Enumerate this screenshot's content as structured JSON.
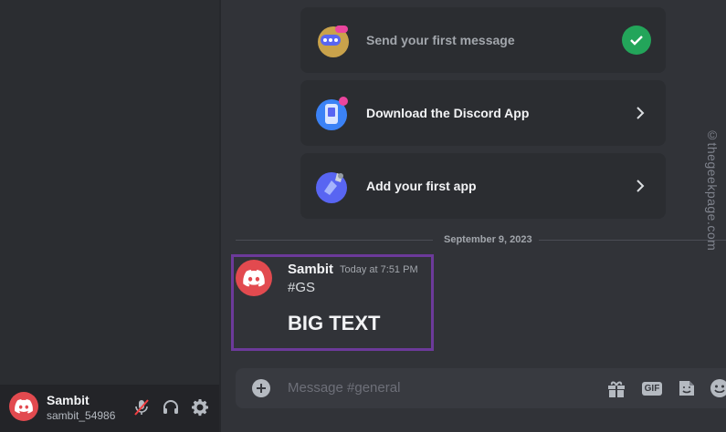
{
  "onboarding": {
    "items": [
      {
        "label": "Send your first message",
        "completed": true
      },
      {
        "label": "Download the Discord App",
        "completed": false
      },
      {
        "label": "Add your first app",
        "completed": false
      }
    ]
  },
  "chat": {
    "date_divider": "September 9, 2023",
    "message": {
      "author": "Sambit",
      "timestamp": "Today at 7:51 PM",
      "line1": "#GS",
      "big_text": "BIG TEXT"
    },
    "composer_placeholder": "Message #general",
    "gif_label": "GIF"
  },
  "user_panel": {
    "username": "Sambit",
    "tag": "sambit_54986"
  },
  "watermark": "©thegeekpage.com",
  "colors": {
    "accent_green": "#23a55a",
    "discord_red": "#e24a4f",
    "highlight_purple": "#6c3a9a"
  }
}
